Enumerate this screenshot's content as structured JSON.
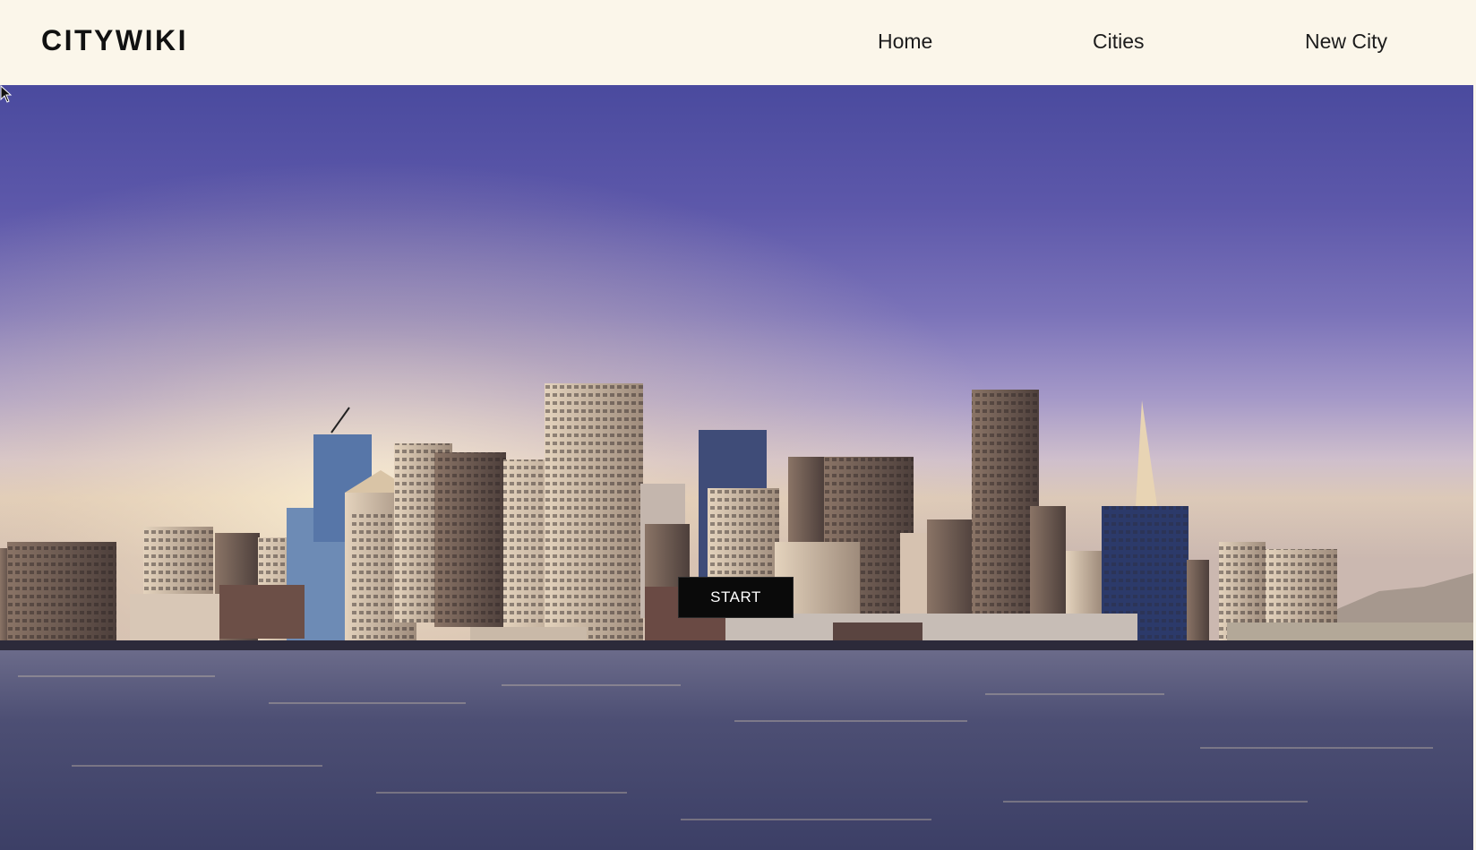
{
  "navbar": {
    "brand": "CITYWIKI",
    "links": [
      "Home",
      "Cities",
      "New City"
    ]
  },
  "hero": {
    "button_label": "START"
  },
  "colors": {
    "navbar_bg": "#fbf6ea",
    "button_bg": "#0a0a0a",
    "button_text": "#ffffff",
    "sky_top": "#4a4a9e",
    "sky_glow": "#dcc9b8",
    "water": "#4a4c72"
  },
  "icons": [
    "mouse-cursor-icon"
  ]
}
